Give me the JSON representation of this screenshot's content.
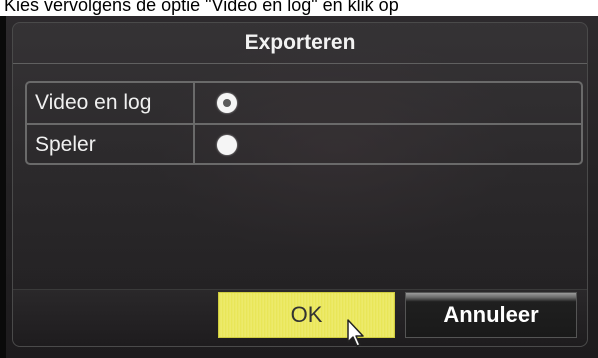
{
  "caption": "Kies vervolgens de optie \"Video en log\" en klik op",
  "dialog": {
    "title": "Exporteren",
    "options": [
      {
        "label": "Video en log",
        "selected": true
      },
      {
        "label": "Speler",
        "selected": false
      }
    ],
    "buttons": {
      "ok_label": "OK",
      "cancel_label": "Annuleer"
    }
  },
  "colors": {
    "ok_button": "#f0ee60",
    "cancel_button": "#1a1a1a",
    "dialog_bg": "#2d2a2d"
  },
  "icons": {
    "cursor": "mouse-pointer-icon"
  }
}
